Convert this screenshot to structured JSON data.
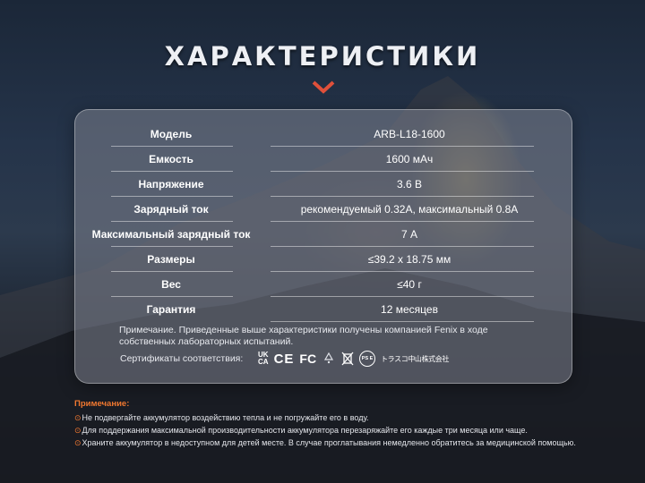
{
  "header": {
    "title": "ХАРАКТЕРИСТИКИ"
  },
  "specs": [
    {
      "label": "Модель",
      "value": "ARB-L18-1600"
    },
    {
      "label": "Емкость",
      "value": "1600 мАч"
    },
    {
      "label": "Напряжение",
      "value": "3.6 В"
    },
    {
      "label": "Зарядный ток",
      "value": "рекомендуемый 0.32А, максимальный 0.8А"
    },
    {
      "label": "Максимальный зарядный ток",
      "value": "7 А"
    },
    {
      "label": "Размеры",
      "value": "≤39.2 x 18.75 мм"
    },
    {
      "label": "Вес",
      "value": "≤40 г"
    },
    {
      "label": "Гарантия",
      "value": "12 месяцев"
    }
  ],
  "card": {
    "note": "Примечание. Приведенные выше характеристики получены компанией Fenix в ходе собственных лабораторных испытаний.",
    "certs_label": "Сертификаты соответствия:",
    "certs": {
      "ukca_top": "UK",
      "ukca_bottom": "CA",
      "ce": "CE",
      "fcc": "FC",
      "pse": "PS E",
      "jp_text": "トラスコ中山株式会社"
    }
  },
  "bottom_notes": {
    "title": "Примечание:",
    "items": [
      "Не подвергайте аккумулятор воздействию тепла и не погружайте его в воду.",
      "Для поддержания максимальной производительности аккумулятора перезаряжайте его каждые три месяца или чаще.",
      "Храните аккумулятор в недоступном для детей месте. В случае проглатывания немедленно обратитесь за медицинской помощью."
    ]
  },
  "colors": {
    "accent": "#f07830",
    "chevron": "#e0503a"
  },
  "icons": [
    "chevron-down-icon",
    "warning-circle-icon",
    "recycle-icon",
    "weee-bin-icon"
  ]
}
